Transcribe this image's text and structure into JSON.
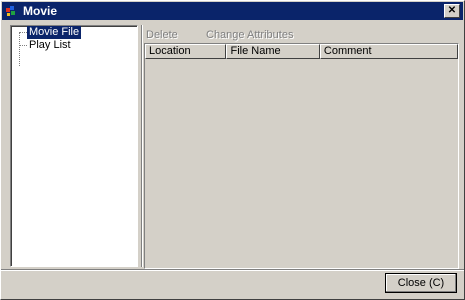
{
  "window": {
    "title": "Movie",
    "close_glyph": "✕"
  },
  "tree": {
    "items": [
      {
        "label": "Movie File",
        "selected": true
      },
      {
        "label": "Play List",
        "selected": false
      }
    ]
  },
  "toolbar": {
    "delete_label": "Delete",
    "change_attributes_label": "Change Attributes"
  },
  "list": {
    "columns": [
      "Location",
      "File Name",
      "Comment"
    ],
    "rows": []
  },
  "footer": {
    "close_label": "Close (C)"
  },
  "colors": {
    "titlebar": "#0a246a",
    "face": "#d4d0c8",
    "disabled_text": "#808080"
  }
}
